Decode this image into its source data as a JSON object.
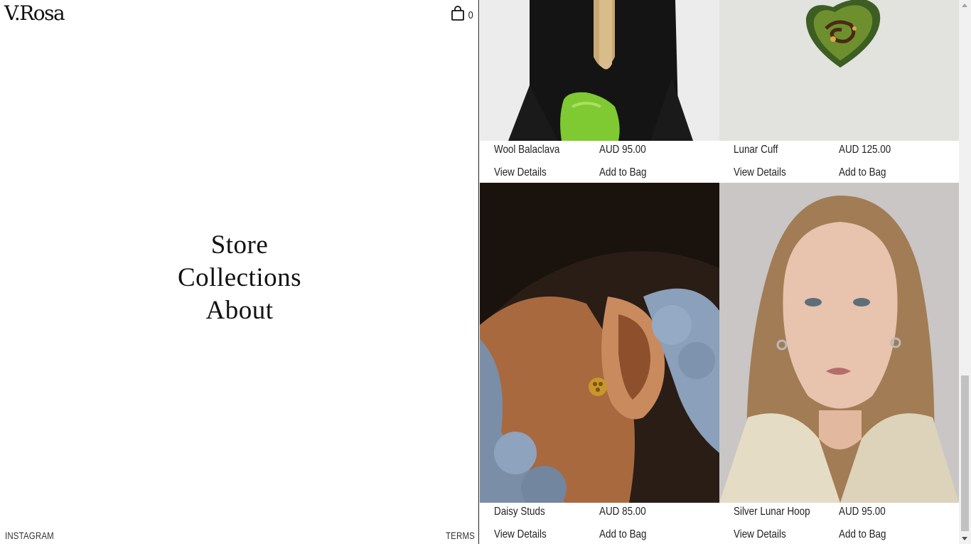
{
  "brand": {
    "logo": "V.Rosa"
  },
  "cart": {
    "count": "0",
    "icon": "shopping-bag-icon"
  },
  "nav": {
    "items": [
      "Store",
      "Collections",
      "About"
    ]
  },
  "footer": {
    "instagram": "INSTAGRAM",
    "terms": "TERMS"
  },
  "products": [
    {
      "name": "Wool Balaclava",
      "price": "AUD 95.00",
      "view": "View Details",
      "add": "Add to Bag"
    },
    {
      "name": "Lunar Cuff",
      "price": "AUD 125.00",
      "view": "View Details",
      "add": "Add to Bag"
    },
    {
      "name": "Daisy Studs",
      "price": "AUD 85.00",
      "view": "View Details",
      "add": "Add to Bag"
    },
    {
      "name": "Silver Lunar Hoop",
      "price": "AUD 95.00",
      "view": "View Details",
      "add": "Add to Bag"
    }
  ]
}
